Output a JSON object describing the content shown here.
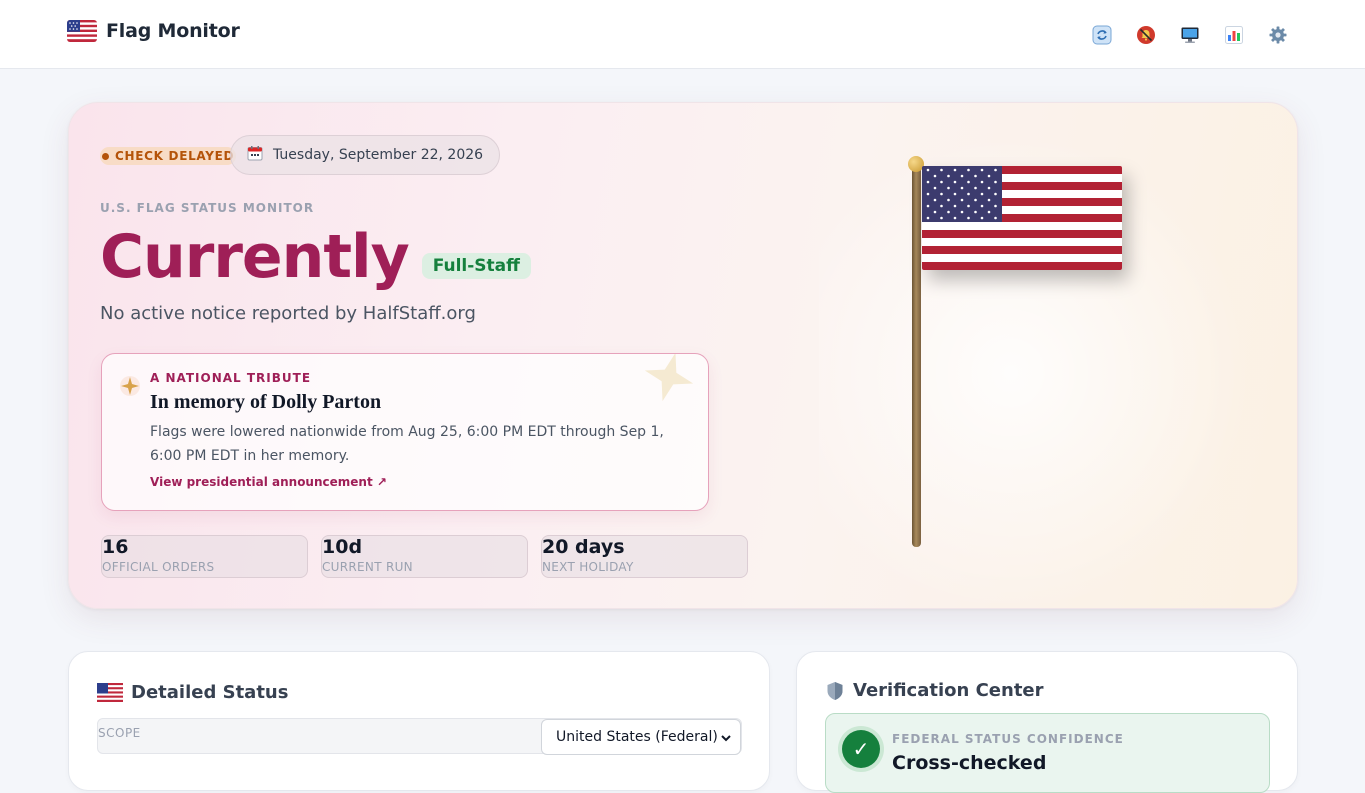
{
  "app": {
    "title": "Flag Monitor",
    "brand_icon": "us-flag-icon"
  },
  "toolbar": {
    "items": [
      {
        "name": "refresh-icon",
        "label": "Refresh"
      },
      {
        "name": "notifications-off-icon",
        "label": "Notifications"
      },
      {
        "name": "display-icon",
        "label": "Display"
      },
      {
        "name": "stats-icon",
        "label": "Statistics"
      },
      {
        "name": "settings-icon",
        "label": "Settings"
      }
    ]
  },
  "hero": {
    "delay_badge": "CHECK DELAYED",
    "date": "Tuesday, September 22, 2026",
    "eyebrow": "U.S. FLAG STATUS MONITOR",
    "headline": "Currently",
    "status": "Full-Staff",
    "subtitle": "No active notice reported by HalfStaff.org",
    "tribute": {
      "eyebrow": "A NATIONAL TRIBUTE",
      "title": "In memory of Dolly Parton",
      "body": "Flags were lowered nationwide from Aug 25, 6:00 PM EDT through Sep 1, 6:00 PM EDT in her memory.",
      "link": "View presidential announcement ↗"
    },
    "stats": [
      {
        "value": "16",
        "label": "OFFICIAL ORDERS"
      },
      {
        "value": "10d",
        "label": "CURRENT RUN"
      },
      {
        "value": "20 days",
        "label": "NEXT HOLIDAY"
      }
    ]
  },
  "colors": {
    "accent": "#9f1f57",
    "success": "#15803d",
    "warning": "#b45309"
  },
  "detailed_status": {
    "title": "Detailed Status",
    "scope_label": "SCOPE",
    "scope_value": "United States (Federal)"
  },
  "verification": {
    "title": "Verification Center",
    "confidence_label": "FEDERAL STATUS CONFIDENCE",
    "confidence_value": "Cross-checked"
  }
}
